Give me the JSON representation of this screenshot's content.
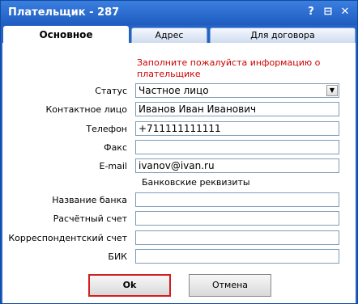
{
  "window": {
    "title": "Плательщик - 287",
    "help": "?",
    "restore": "⊟",
    "close": "✕"
  },
  "tabs": [
    {
      "label": "Основное",
      "active": true
    },
    {
      "label": "Адрес",
      "active": false
    },
    {
      "label": "Для договора",
      "active": false
    }
  ],
  "form": {
    "notice": "Заполните пожалуйста информацию о плательщике",
    "status_label": "Статус",
    "status_value": "Частное лицо",
    "contact_label": "Контактное лицо",
    "contact_value": "Иванов Иван Иванович",
    "phone_label": "Телефон",
    "phone_value": "+711111111111",
    "fax_label": "Факс",
    "fax_value": "",
    "email_label": "E-mail",
    "email_value": "ivanov@ivan.ru",
    "bank_section": "Банковские реквизиты",
    "bank_name_label": "Название банка",
    "bank_name_value": "",
    "account_label": "Расчётный счет",
    "account_value": "",
    "corr_account_label": "Корреспондентский счет",
    "corr_account_value": "",
    "bik_label": "БИК",
    "bik_value": ""
  },
  "buttons": {
    "ok": "Ok",
    "cancel": "Отмена"
  },
  "colors": {
    "titlebar": "#2463c5",
    "notice": "#cc0000",
    "ok_border": "#d21f1f"
  }
}
